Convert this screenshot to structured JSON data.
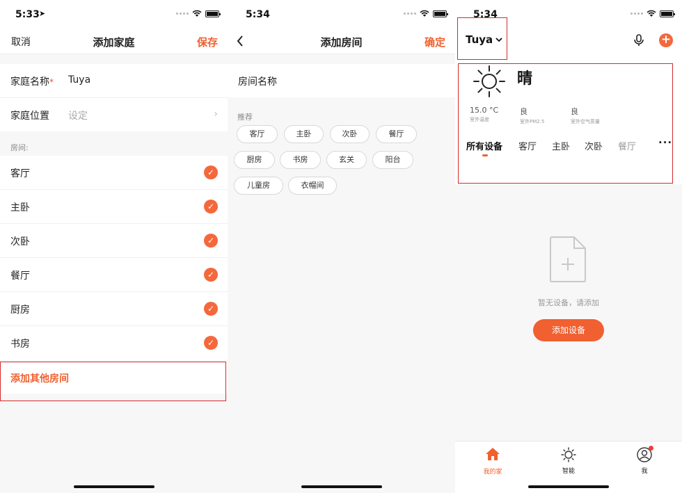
{
  "screen1": {
    "time": "5:33",
    "nav": {
      "cancel": "取消",
      "title": "添加家庭",
      "save": "保存"
    },
    "family_name_label": "家庭名称",
    "family_name_required": "*",
    "family_name_value": "Tuya",
    "family_location_label": "家庭位置",
    "family_location_placeholder": "设定",
    "rooms_section_label": "房间:",
    "rooms": [
      {
        "label": "客厅",
        "checked": true
      },
      {
        "label": "主卧",
        "checked": true
      },
      {
        "label": "次卧",
        "checked": true
      },
      {
        "label": "餐厅",
        "checked": true
      },
      {
        "label": "厨房",
        "checked": true
      },
      {
        "label": "书房",
        "checked": true
      }
    ],
    "add_other_rooms": "添加其他房间"
  },
  "screen2": {
    "time": "5:34",
    "nav": {
      "title": "添加房间",
      "confirm": "确定"
    },
    "room_name_label": "房间名称",
    "recommend_label": "推荐",
    "chips": [
      "客厅",
      "主卧",
      "次卧",
      "餐厅",
      "厨房",
      "书房",
      "玄关",
      "阳台",
      "儿童房",
      "衣帽间"
    ]
  },
  "screen3": {
    "time": "5:34",
    "home_name": "Tuya",
    "weather": {
      "condition": "晴",
      "stats": [
        {
          "value": "15.0 °C",
          "label": "室外温度"
        },
        {
          "value": "良",
          "label": "室外PM2.5"
        },
        {
          "value": "良",
          "label": "室外空气质量"
        }
      ]
    },
    "room_tabs": [
      "所有设备",
      "客厅",
      "主卧",
      "次卧",
      "餐厅"
    ],
    "empty_text": "暂无设备，请添加",
    "add_device_button": "添加设备",
    "tabbar": [
      "我的家",
      "智能",
      "我"
    ],
    "colors": {
      "accent": "#f06030",
      "highlight_box": "#d42a2a"
    }
  }
}
